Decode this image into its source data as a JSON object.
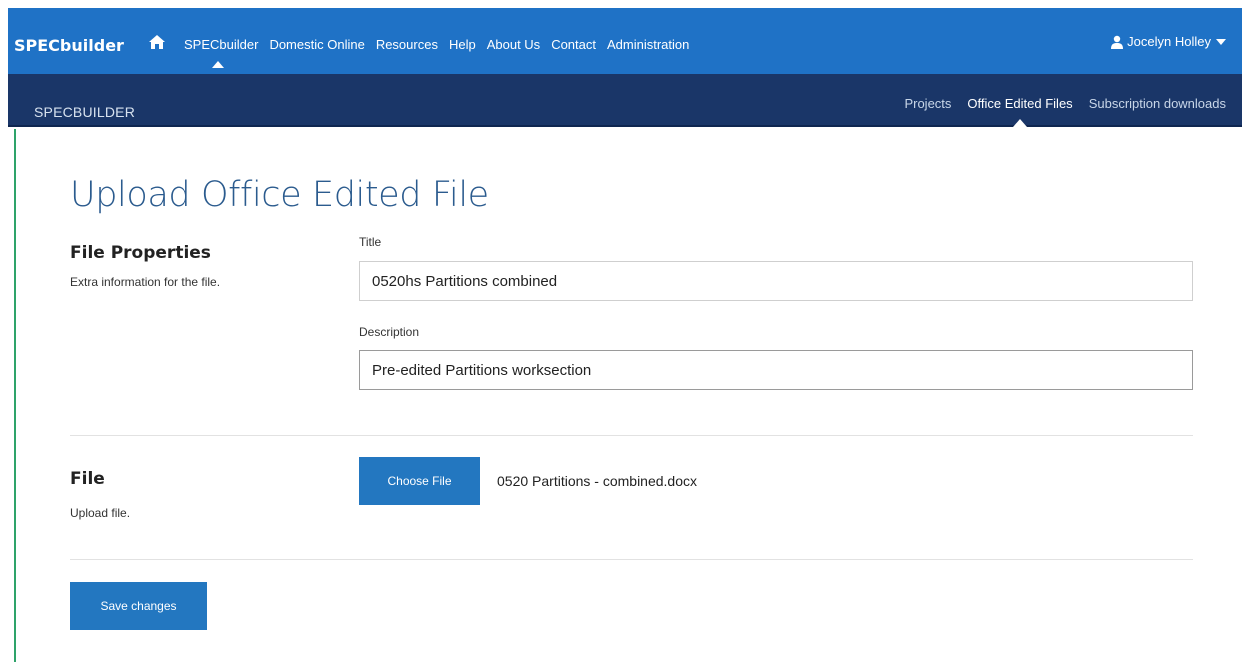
{
  "navbar": {
    "brand": "SPECbuilder",
    "items": [
      "SPECbuilder",
      "Domestic Online",
      "Resources",
      "Help",
      "About Us",
      "Contact",
      "Administration"
    ],
    "active_index": 0,
    "user": "Jocelyn Holley"
  },
  "subnav": {
    "brand": "SPECBUILDER",
    "items": [
      "Projects",
      "Office Edited Files",
      "Subscription downloads"
    ],
    "active_index": 1
  },
  "page": {
    "title": "Upload Office Edited File",
    "file_properties": {
      "heading": "File Properties",
      "subtext": "Extra information for the file.",
      "title_label": "Title",
      "title_value": "0520hs Partitions combined",
      "description_label": "Description",
      "description_value": "Pre-edited Partitions worksection"
    },
    "file_section": {
      "heading": "File",
      "subtext": "Upload file.",
      "choose_button": "Choose File",
      "chosen_file": "0520 Partitions - combined.docx"
    },
    "save_button": "Save changes"
  },
  "colors": {
    "navbar": "#1f72c6",
    "subnav": "#1a3668",
    "title": "#2b5b8e",
    "button": "#2377c0",
    "left_accent": "#2ea36a"
  },
  "icons": {
    "home": "home-icon",
    "user": "user-icon",
    "caret": "caret-down-icon"
  }
}
